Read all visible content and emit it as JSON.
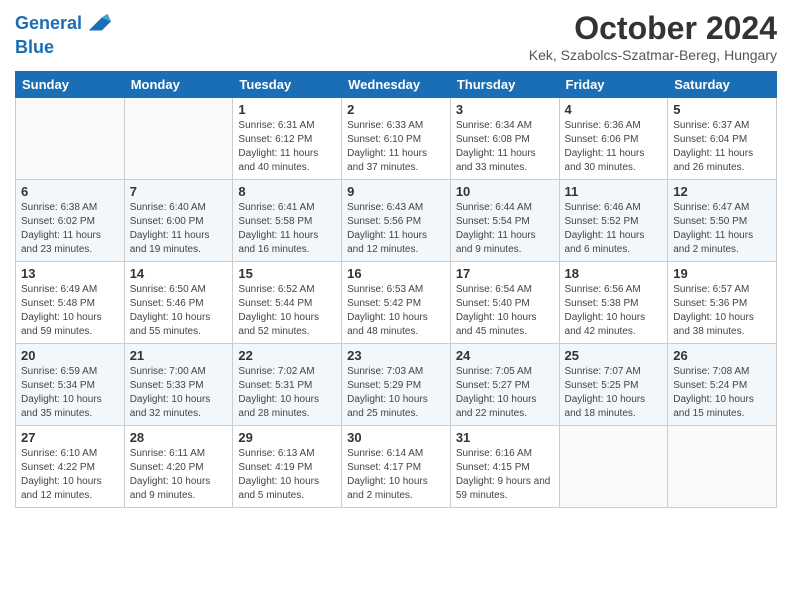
{
  "logo": {
    "line1": "General",
    "line2": "Blue"
  },
  "title": "October 2024",
  "location": "Kek, Szabolcs-Szatmar-Bereg, Hungary",
  "days_of_week": [
    "Sunday",
    "Monday",
    "Tuesday",
    "Wednesday",
    "Thursday",
    "Friday",
    "Saturday"
  ],
  "weeks": [
    [
      {
        "day": "",
        "sunrise": "",
        "sunset": "",
        "daylight": ""
      },
      {
        "day": "",
        "sunrise": "",
        "sunset": "",
        "daylight": ""
      },
      {
        "day": "1",
        "sunrise": "Sunrise: 6:31 AM",
        "sunset": "Sunset: 6:12 PM",
        "daylight": "Daylight: 11 hours and 40 minutes."
      },
      {
        "day": "2",
        "sunrise": "Sunrise: 6:33 AM",
        "sunset": "Sunset: 6:10 PM",
        "daylight": "Daylight: 11 hours and 37 minutes."
      },
      {
        "day": "3",
        "sunrise": "Sunrise: 6:34 AM",
        "sunset": "Sunset: 6:08 PM",
        "daylight": "Daylight: 11 hours and 33 minutes."
      },
      {
        "day": "4",
        "sunrise": "Sunrise: 6:36 AM",
        "sunset": "Sunset: 6:06 PM",
        "daylight": "Daylight: 11 hours and 30 minutes."
      },
      {
        "day": "5",
        "sunrise": "Sunrise: 6:37 AM",
        "sunset": "Sunset: 6:04 PM",
        "daylight": "Daylight: 11 hours and 26 minutes."
      }
    ],
    [
      {
        "day": "6",
        "sunrise": "Sunrise: 6:38 AM",
        "sunset": "Sunset: 6:02 PM",
        "daylight": "Daylight: 11 hours and 23 minutes."
      },
      {
        "day": "7",
        "sunrise": "Sunrise: 6:40 AM",
        "sunset": "Sunset: 6:00 PM",
        "daylight": "Daylight: 11 hours and 19 minutes."
      },
      {
        "day": "8",
        "sunrise": "Sunrise: 6:41 AM",
        "sunset": "Sunset: 5:58 PM",
        "daylight": "Daylight: 11 hours and 16 minutes."
      },
      {
        "day": "9",
        "sunrise": "Sunrise: 6:43 AM",
        "sunset": "Sunset: 5:56 PM",
        "daylight": "Daylight: 11 hours and 12 minutes."
      },
      {
        "day": "10",
        "sunrise": "Sunrise: 6:44 AM",
        "sunset": "Sunset: 5:54 PM",
        "daylight": "Daylight: 11 hours and 9 minutes."
      },
      {
        "day": "11",
        "sunrise": "Sunrise: 6:46 AM",
        "sunset": "Sunset: 5:52 PM",
        "daylight": "Daylight: 11 hours and 6 minutes."
      },
      {
        "day": "12",
        "sunrise": "Sunrise: 6:47 AM",
        "sunset": "Sunset: 5:50 PM",
        "daylight": "Daylight: 11 hours and 2 minutes."
      }
    ],
    [
      {
        "day": "13",
        "sunrise": "Sunrise: 6:49 AM",
        "sunset": "Sunset: 5:48 PM",
        "daylight": "Daylight: 10 hours and 59 minutes."
      },
      {
        "day": "14",
        "sunrise": "Sunrise: 6:50 AM",
        "sunset": "Sunset: 5:46 PM",
        "daylight": "Daylight: 10 hours and 55 minutes."
      },
      {
        "day": "15",
        "sunrise": "Sunrise: 6:52 AM",
        "sunset": "Sunset: 5:44 PM",
        "daylight": "Daylight: 10 hours and 52 minutes."
      },
      {
        "day": "16",
        "sunrise": "Sunrise: 6:53 AM",
        "sunset": "Sunset: 5:42 PM",
        "daylight": "Daylight: 10 hours and 48 minutes."
      },
      {
        "day": "17",
        "sunrise": "Sunrise: 6:54 AM",
        "sunset": "Sunset: 5:40 PM",
        "daylight": "Daylight: 10 hours and 45 minutes."
      },
      {
        "day": "18",
        "sunrise": "Sunrise: 6:56 AM",
        "sunset": "Sunset: 5:38 PM",
        "daylight": "Daylight: 10 hours and 42 minutes."
      },
      {
        "day": "19",
        "sunrise": "Sunrise: 6:57 AM",
        "sunset": "Sunset: 5:36 PM",
        "daylight": "Daylight: 10 hours and 38 minutes."
      }
    ],
    [
      {
        "day": "20",
        "sunrise": "Sunrise: 6:59 AM",
        "sunset": "Sunset: 5:34 PM",
        "daylight": "Daylight: 10 hours and 35 minutes."
      },
      {
        "day": "21",
        "sunrise": "Sunrise: 7:00 AM",
        "sunset": "Sunset: 5:33 PM",
        "daylight": "Daylight: 10 hours and 32 minutes."
      },
      {
        "day": "22",
        "sunrise": "Sunrise: 7:02 AM",
        "sunset": "Sunset: 5:31 PM",
        "daylight": "Daylight: 10 hours and 28 minutes."
      },
      {
        "day": "23",
        "sunrise": "Sunrise: 7:03 AM",
        "sunset": "Sunset: 5:29 PM",
        "daylight": "Daylight: 10 hours and 25 minutes."
      },
      {
        "day": "24",
        "sunrise": "Sunrise: 7:05 AM",
        "sunset": "Sunset: 5:27 PM",
        "daylight": "Daylight: 10 hours and 22 minutes."
      },
      {
        "day": "25",
        "sunrise": "Sunrise: 7:07 AM",
        "sunset": "Sunset: 5:25 PM",
        "daylight": "Daylight: 10 hours and 18 minutes."
      },
      {
        "day": "26",
        "sunrise": "Sunrise: 7:08 AM",
        "sunset": "Sunset: 5:24 PM",
        "daylight": "Daylight: 10 hours and 15 minutes."
      }
    ],
    [
      {
        "day": "27",
        "sunrise": "Sunrise: 6:10 AM",
        "sunset": "Sunset: 4:22 PM",
        "daylight": "Daylight: 10 hours and 12 minutes."
      },
      {
        "day": "28",
        "sunrise": "Sunrise: 6:11 AM",
        "sunset": "Sunset: 4:20 PM",
        "daylight": "Daylight: 10 hours and 9 minutes."
      },
      {
        "day": "29",
        "sunrise": "Sunrise: 6:13 AM",
        "sunset": "Sunset: 4:19 PM",
        "daylight": "Daylight: 10 hours and 5 minutes."
      },
      {
        "day": "30",
        "sunrise": "Sunrise: 6:14 AM",
        "sunset": "Sunset: 4:17 PM",
        "daylight": "Daylight: 10 hours and 2 minutes."
      },
      {
        "day": "31",
        "sunrise": "Sunrise: 6:16 AM",
        "sunset": "Sunset: 4:15 PM",
        "daylight": "Daylight: 9 hours and 59 minutes."
      },
      {
        "day": "",
        "sunrise": "",
        "sunset": "",
        "daylight": ""
      },
      {
        "day": "",
        "sunrise": "",
        "sunset": "",
        "daylight": ""
      }
    ]
  ]
}
